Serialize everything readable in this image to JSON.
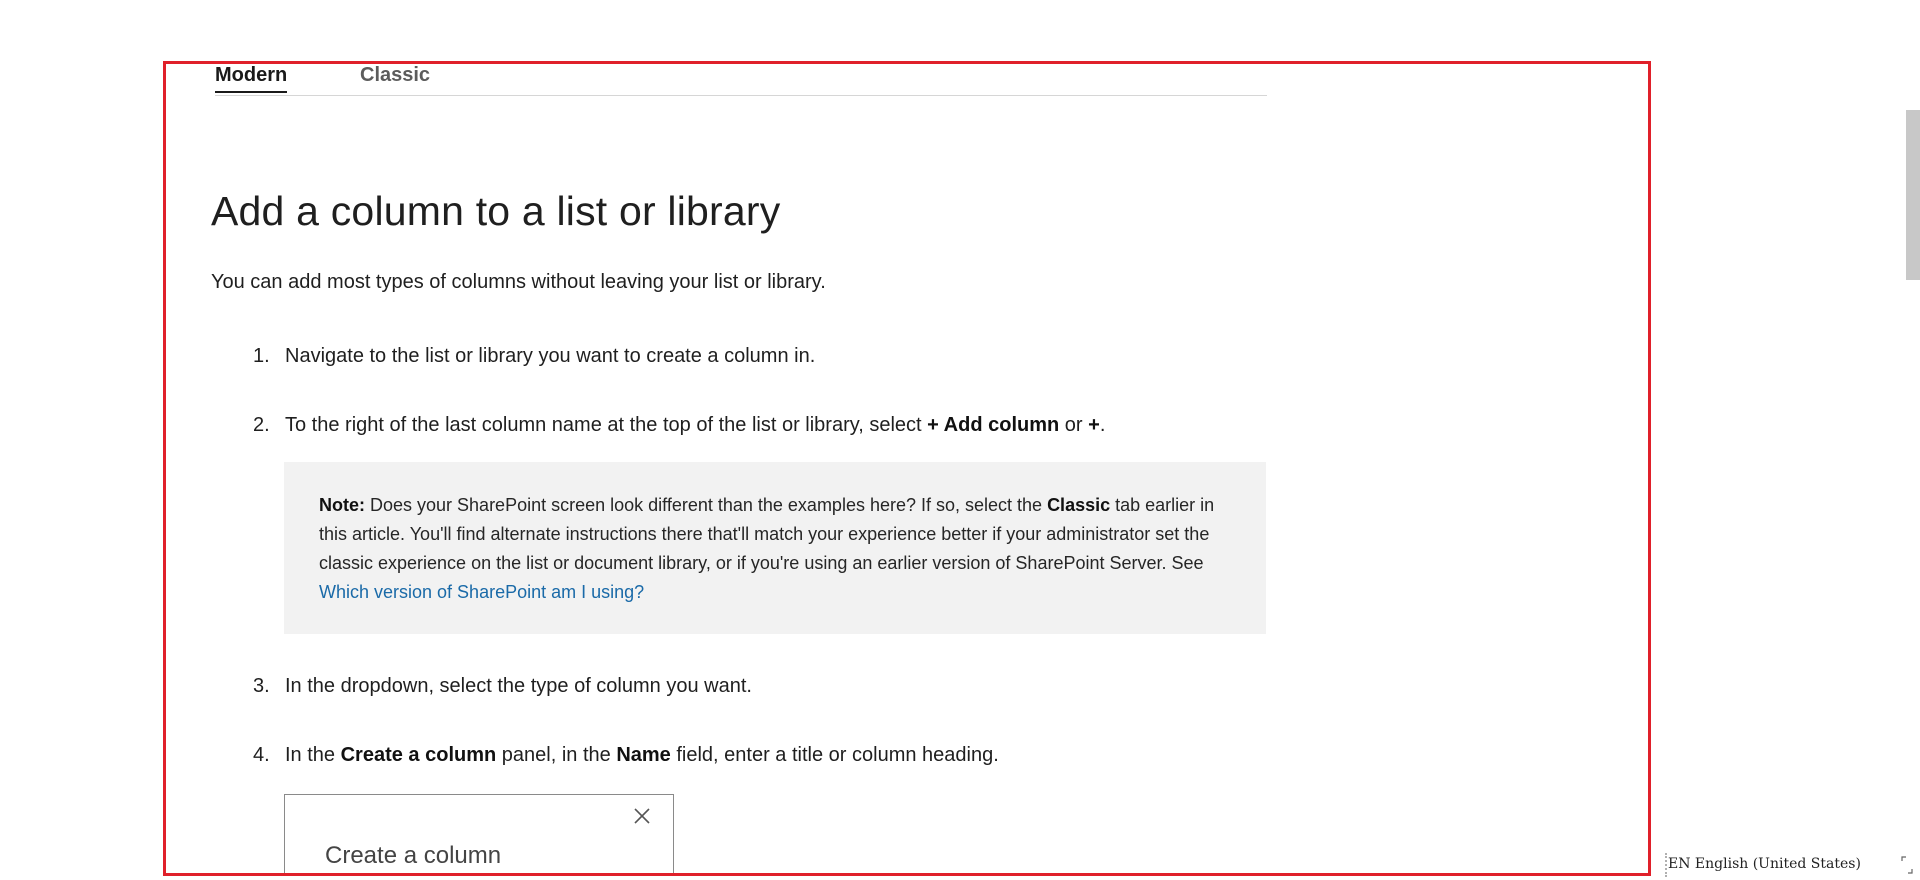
{
  "tabs": [
    {
      "label": "Modern",
      "selected": true
    },
    {
      "label": "Classic",
      "selected": false
    }
  ],
  "article": {
    "title": "Add a column to a list or library",
    "intro": "You can add most types of columns without leaving your list or library.",
    "steps": [
      {
        "num": "1.",
        "text": "Navigate to the list or library you want to create a column in."
      },
      {
        "num": "2.",
        "pre": "To the right of the last column name at the top of the list or library, select ",
        "bold1": "+ Add column",
        "mid": " or ",
        "bold2": "+",
        "post": "."
      },
      {
        "num": "3.",
        "text": "In the dropdown, select the type of column you want."
      },
      {
        "num": "4.",
        "pre": "In the ",
        "bold1": "Create a column",
        "mid": " panel, in the ",
        "bold2": "Name",
        "post": " field, enter a title or column heading."
      }
    ],
    "note": {
      "label": "Note:",
      "text1": " Does your SharePoint screen look different than the examples here? If so, select the ",
      "bold": "Classic",
      "text2": " tab earlier in this article. You'll find alternate instructions there that'll match your experience better if your administrator set the classic experience on the list or document library, or if you're using an earlier version of SharePoint Server. See ",
      "link": "Which version of SharePoint am I using?"
    },
    "panel": {
      "title": "Create a column",
      "close_icon": "close-icon"
    }
  },
  "statusbar": {
    "language": "EN English (United States)"
  },
  "colors": {
    "frame": "#e0202a",
    "link": "#1a6aa8",
    "note_bg": "#f2f2f2"
  }
}
